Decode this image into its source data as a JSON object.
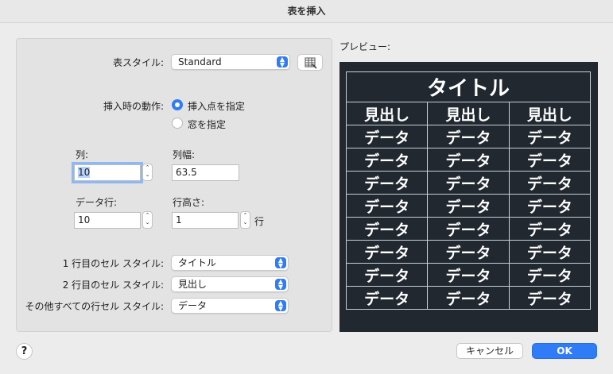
{
  "window": {
    "title": "表を挿入"
  },
  "table_style": {
    "label": "表スタイル:",
    "value": "Standard",
    "icon": "table-style-icon"
  },
  "insert_behavior": {
    "label": "挿入時の動作:",
    "options": [
      {
        "label": "挿入点を指定",
        "selected": true
      },
      {
        "label": "窓を指定",
        "selected": false
      }
    ]
  },
  "columns": {
    "label": "列:",
    "value": "10"
  },
  "column_width": {
    "label": "列幅:",
    "value": "63.5"
  },
  "data_rows": {
    "label": "データ行:",
    "value": "10"
  },
  "row_height": {
    "label": "行高さ:",
    "value": "1",
    "unit": "行"
  },
  "cell_styles": {
    "row1": {
      "label": "1 行目のセル スタイル:",
      "value": "タイトル"
    },
    "row2": {
      "label": "2 行目のセル スタイル:",
      "value": "見出し"
    },
    "others": {
      "label": "その他すべての行セル スタイル:",
      "value": "データ"
    }
  },
  "preview": {
    "label": "プレビュー:",
    "title": "タイトル",
    "headers": [
      "見出し",
      "見出し",
      "見出し"
    ],
    "data_rows": [
      [
        "データ",
        "データ",
        "データ"
      ],
      [
        "データ",
        "データ",
        "データ"
      ],
      [
        "データ",
        "データ",
        "データ"
      ],
      [
        "データ",
        "データ",
        "データ"
      ],
      [
        "データ",
        "データ",
        "データ"
      ],
      [
        "データ",
        "データ",
        "データ"
      ],
      [
        "データ",
        "データ",
        "データ"
      ],
      [
        "データ",
        "データ",
        "データ"
      ]
    ],
    "background": "#212830"
  },
  "buttons": {
    "help": "?",
    "cancel": "キャンセル",
    "ok": "OK"
  },
  "colors": {
    "accent": "#2f7cf6"
  }
}
